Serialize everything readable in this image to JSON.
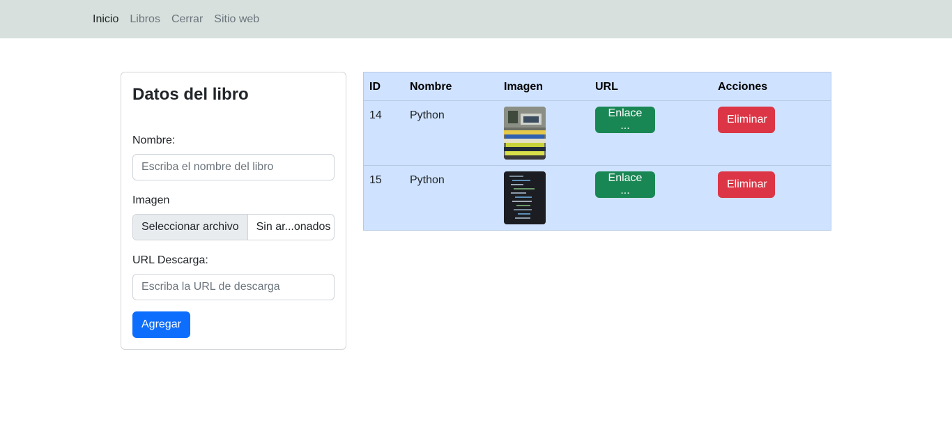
{
  "nav": {
    "items": [
      {
        "label": "Inicio"
      },
      {
        "label": "Libros"
      },
      {
        "label": "Cerrar"
      },
      {
        "label": "Sitio web"
      }
    ]
  },
  "form": {
    "title": "Datos del libro",
    "nombre_label": "Nombre:",
    "nombre_placeholder": "Escriba el nombre del libro",
    "nombre_value": "",
    "imagen_label": "Imagen",
    "file_button": "Seleccionar archivo",
    "file_status": "Sin ar...onados",
    "url_label": "URL Descarga:",
    "url_placeholder": "Escriba la URL de descarga",
    "url_value": "",
    "submit_label": "Agregar"
  },
  "table": {
    "headers": [
      "ID",
      "Nombre",
      "Imagen",
      "URL",
      "Acciones"
    ],
    "rows": [
      {
        "id": "14",
        "nombre": "Python",
        "url_label": "Enlace ...",
        "action_label": "Eliminar"
      },
      {
        "id": "15",
        "nombre": "Python",
        "url_label": "Enlace ...",
        "action_label": "Eliminar"
      }
    ]
  },
  "colors": {
    "navbar_bg": "#d7e0dc",
    "table_bg": "#cfe2ff",
    "primary": "#0d6efd",
    "success": "#198754",
    "danger": "#dc3545"
  }
}
